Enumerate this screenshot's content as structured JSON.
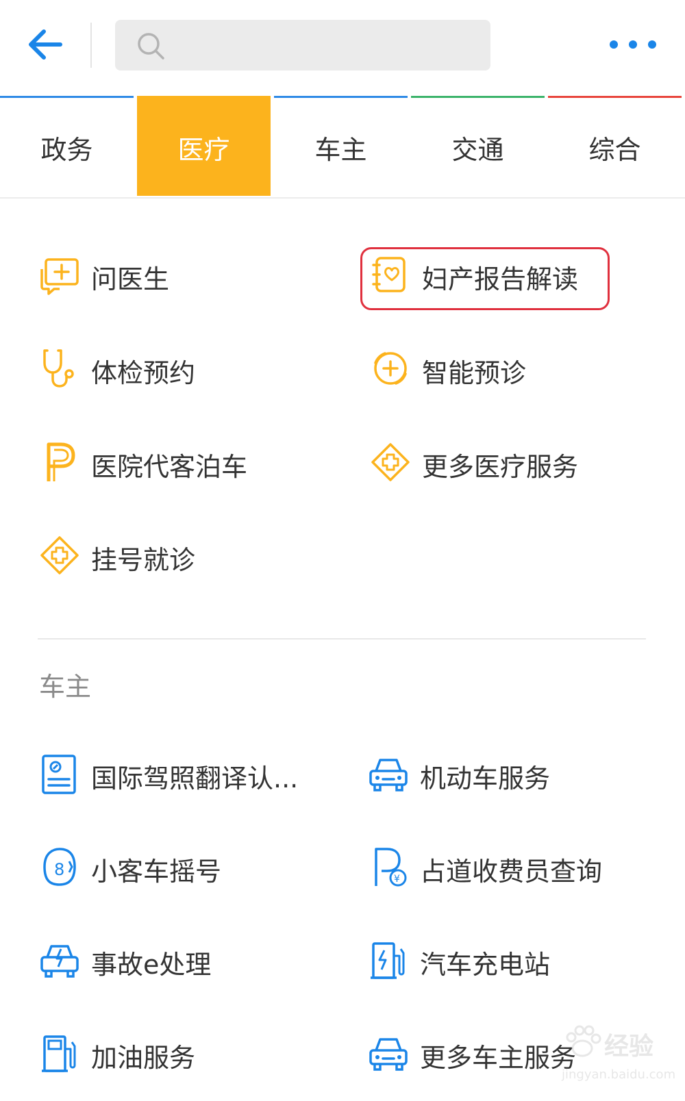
{
  "header": {
    "search_placeholder": ""
  },
  "tabs": [
    {
      "label": "政务",
      "bar_color": "#2e8ae6",
      "active": false
    },
    {
      "label": "医疗",
      "bar_color": "#fcb31d",
      "active": true
    },
    {
      "label": "车主",
      "bar_color": "#2e8ae6",
      "active": false
    },
    {
      "label": "交通",
      "bar_color": "#3bb36a",
      "active": false
    },
    {
      "label": "综合",
      "bar_color": "#e8453c",
      "active": false
    }
  ],
  "medical": {
    "items": [
      {
        "label": "问医生",
        "icon": "chat-plus-icon"
      },
      {
        "label": "妇产报告解读",
        "icon": "heart-notebook-icon"
      },
      {
        "label": "体检预约",
        "icon": "stethoscope-icon"
      },
      {
        "label": "智能预诊",
        "icon": "medical-circle-icon"
      },
      {
        "label": "医院代客泊车",
        "icon": "parking-icon"
      },
      {
        "label": "更多医疗服务",
        "icon": "medical-cross-diamond-icon"
      },
      {
        "label": "挂号就诊",
        "icon": "medical-cross-diamond-icon"
      }
    ]
  },
  "car_owner": {
    "section_title": "车主",
    "items": [
      {
        "label": "国际驾照翻译认...",
        "icon": "license-doc-icon"
      },
      {
        "label": "机动车服务",
        "icon": "car-icon"
      },
      {
        "label": "小客车摇号",
        "icon": "lottery-8-icon"
      },
      {
        "label": "占道收费员查询",
        "icon": "parking-fee-icon"
      },
      {
        "label": "事故e处理",
        "icon": "car-accident-icon"
      },
      {
        "label": "汽车充电站",
        "icon": "charging-station-icon"
      },
      {
        "label": "加油服务",
        "icon": "gas-station-icon"
      },
      {
        "label": "更多车主服务",
        "icon": "car-icon"
      }
    ]
  },
  "watermark": {
    "text": "经验",
    "url": "jingyan.baidu.com"
  },
  "colors": {
    "accent_orange": "#fcb31d",
    "accent_blue": "#1a85e8",
    "highlight_red": "#e0303e"
  }
}
